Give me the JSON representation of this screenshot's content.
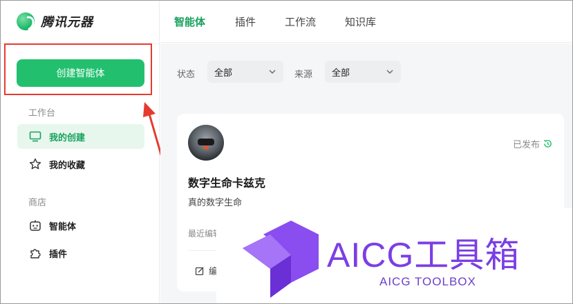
{
  "app": {
    "name": "腾讯元器"
  },
  "sidebar": {
    "create_button_label": "创建智能体",
    "workspace_title": "工作台",
    "workspace_items": [
      {
        "label": "我的创建",
        "icon": "monitor-icon",
        "active": true
      },
      {
        "label": "我的收藏",
        "icon": "star-icon",
        "active": false
      }
    ],
    "store_title": "商店",
    "store_items": [
      {
        "label": "智能体",
        "icon": "robot-icon"
      },
      {
        "label": "插件",
        "icon": "puzzle-icon"
      }
    ]
  },
  "tabs": [
    {
      "label": "智能体",
      "active": true
    },
    {
      "label": "插件",
      "active": false
    },
    {
      "label": "工作流",
      "active": false
    },
    {
      "label": "知识库",
      "active": false
    }
  ],
  "filters": {
    "status_label": "状态",
    "status_value": "全部",
    "source_label": "来源",
    "source_value": "全部"
  },
  "card": {
    "name": "数字生命卡兹克",
    "description": "真的数字生命",
    "status": "已发布",
    "edit_time_label": "最近编辑",
    "edit_button_label": "编"
  },
  "watermark": {
    "title": "AICG工具箱",
    "subtitle": "AICG TOOLBOX"
  },
  "colors": {
    "accent": "#22c06e",
    "active_text": "#17a15d",
    "highlight": "#e53a2e",
    "watermark": "#7b3fe4"
  }
}
